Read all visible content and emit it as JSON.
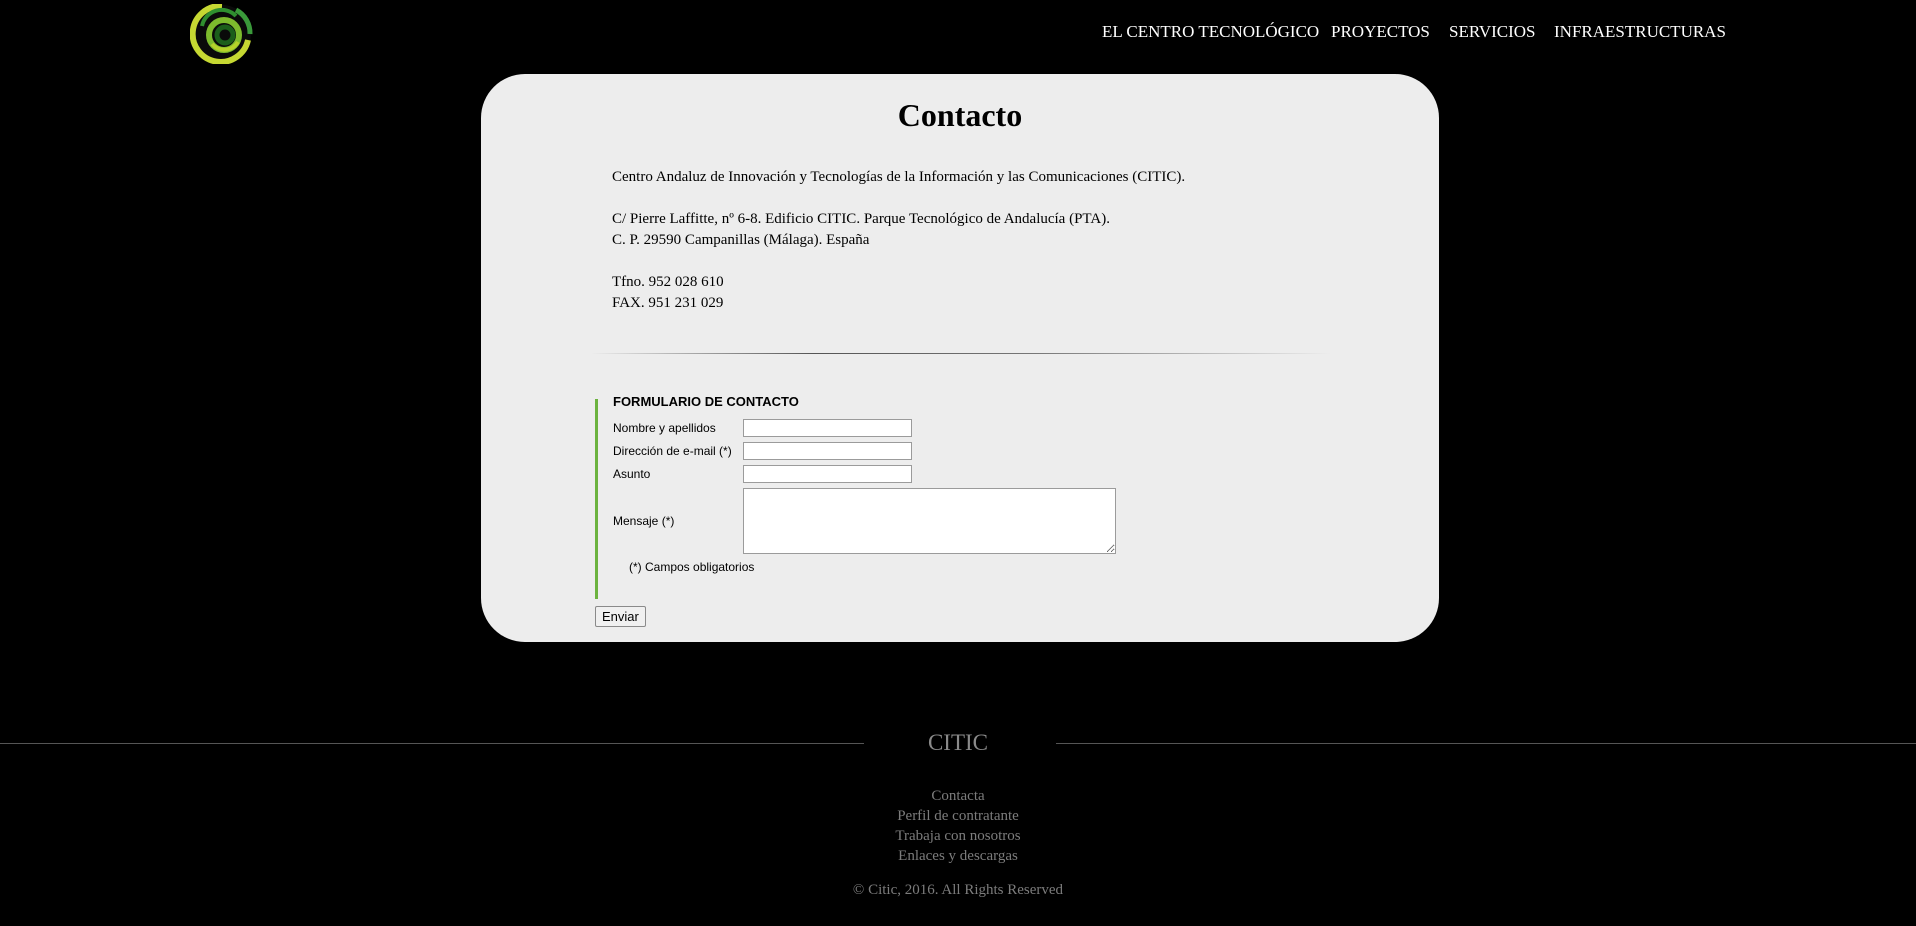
{
  "header": {
    "logo_icon": "citic-swirl-logo",
    "nav": [
      "EL CENTRO TECNOLÓGICO",
      "PROYECTOS",
      "SERVICIOS",
      "INFRAESTRUCTURAS"
    ]
  },
  "main": {
    "title": "Contacto",
    "organization": "Centro Andaluz de Innovación y Tecnologías de la Información y las Comunicaciones (CITIC).",
    "address_line1": "C/ Pierre Laffitte, nº 6-8. Edificio CITIC. Parque Tecnológico de Andalucía (PTA).",
    "address_line2": "C. P. 29590 Campanillas (Málaga). España",
    "phone": "Tfno. 952 028 610",
    "fax": "FAX. 951 231 029"
  },
  "form": {
    "title": "FORMULARIO DE CONTACTO",
    "name_label": "Nombre y apellidos",
    "name_value": "",
    "email_label": "Dirección de e-mail (*)",
    "email_value": "",
    "subject_label": "Asunto",
    "subject_value": "",
    "message_label": "Mensaje (*)",
    "message_value": "",
    "required_note": "(*) Campos obligatorios",
    "submit_label": "Enviar"
  },
  "footer": {
    "brand": "CITIC",
    "links": [
      "Contacta",
      "Perfil de contratante",
      "Trabaja con nosotros",
      "Enlaces y descargas"
    ],
    "copyright": "© Citic, 2016. All Rights Reserved"
  },
  "colors": {
    "background": "#000000",
    "panel": "#ededed",
    "accent_green": "#6cb33f",
    "footer_text": "#7c7c7c"
  }
}
